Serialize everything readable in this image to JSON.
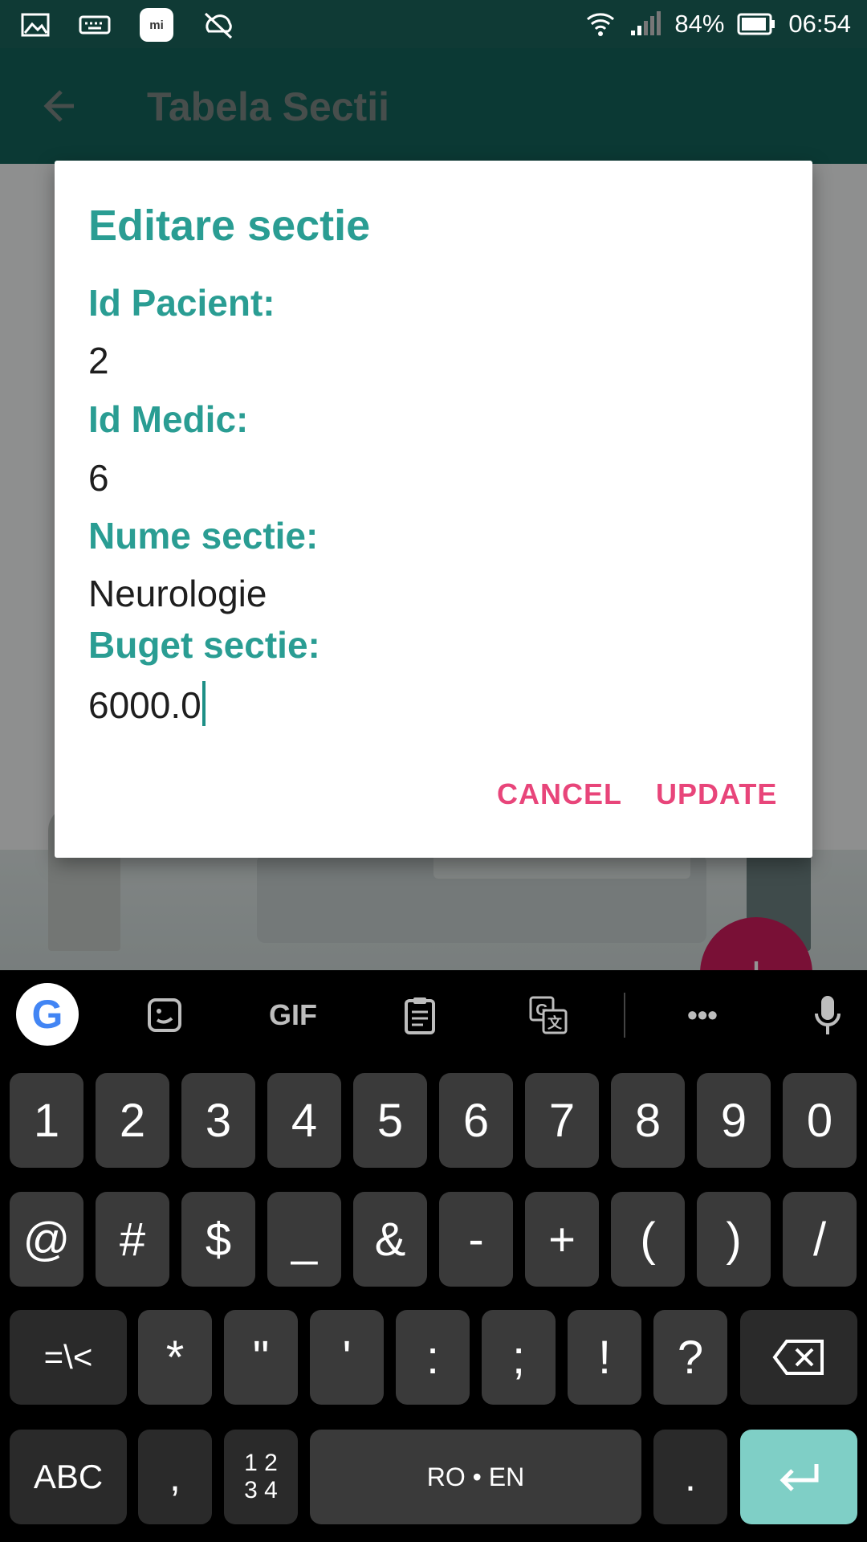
{
  "status_bar": {
    "battery": "84%",
    "time": "06:54",
    "icons": [
      "gallery-icon",
      "keyboard-icon",
      "mi-icon",
      "sync-off-icon",
      "wifi-icon",
      "signal-icon",
      "battery-icon"
    ]
  },
  "app_bar": {
    "title": "Tabela Sectii",
    "back_icon": "arrow-left-icon"
  },
  "dialog": {
    "title": "Editare sectie",
    "fields": [
      {
        "label": "Id Pacient:",
        "value": "2"
      },
      {
        "label": "Id Medic:",
        "value": "6"
      },
      {
        "label": "Nume sectie:",
        "value": "Neurologie"
      },
      {
        "label": "Buget sectie:",
        "value": "6000.0"
      }
    ],
    "cancel_label": "CANCEL",
    "update_label": "UPDATE"
  },
  "fab": {
    "icon": "plus-icon",
    "label": "+"
  },
  "keyboard": {
    "toolbar": {
      "google": "G",
      "gif": "GIF",
      "more": "•••"
    },
    "row1": [
      "1",
      "2",
      "3",
      "4",
      "5",
      "6",
      "7",
      "8",
      "9",
      "0"
    ],
    "row2": [
      "@",
      "#",
      "$",
      "_",
      "&",
      "-",
      "+",
      "(",
      ")",
      "/"
    ],
    "row3": [
      "=\\<",
      "*",
      "\"",
      "'",
      ":",
      ";",
      "!",
      "?"
    ],
    "row4": {
      "abc": "ABC",
      "comma": ",",
      "numpad_top": "1 2",
      "numpad_bottom": "3 4",
      "space": "RO • EN",
      "period": "."
    }
  },
  "colors": {
    "appbar": "#14635a",
    "accent": "#2a9d93",
    "button": "#e8457a",
    "fab": "#d11c5e",
    "enter_key": "#7fcfc6"
  }
}
